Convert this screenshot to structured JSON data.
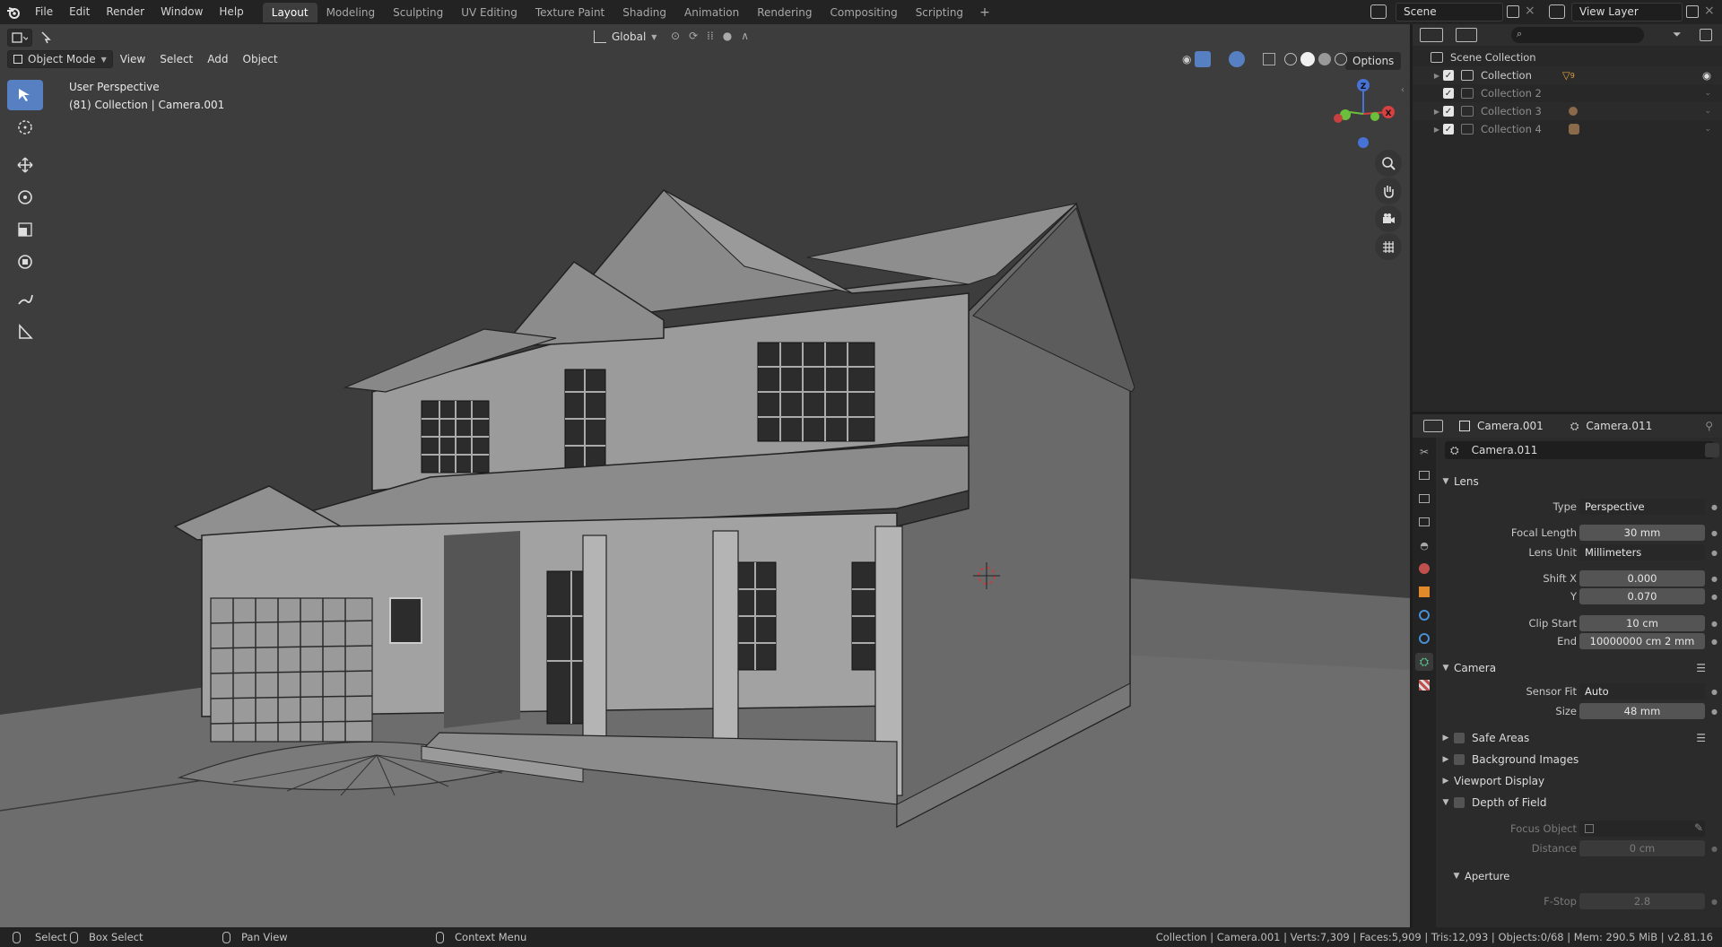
{
  "menu": {
    "items": [
      "File",
      "Edit",
      "Render",
      "Window",
      "Help"
    ]
  },
  "workspaces": {
    "tabs": [
      "Layout",
      "Modeling",
      "Sculpting",
      "UV Editing",
      "Texture Paint",
      "Shading",
      "Animation",
      "Rendering",
      "Compositing",
      "Scripting"
    ],
    "active": "Layout",
    "add_label": "+"
  },
  "scene": {
    "name": "Scene",
    "view_layer": "View Layer"
  },
  "viewport": {
    "mode": "Object Mode",
    "menus": [
      "View",
      "Select",
      "Add",
      "Object"
    ],
    "orientation": "Global",
    "options_label": "Options",
    "info_line1": "User Perspective",
    "info_line2": "(81) Collection | Camera.001",
    "gizmo": {
      "x": "X",
      "z": "Z"
    }
  },
  "outliner": {
    "root": "Scene Collection",
    "items": [
      {
        "label": "Collection",
        "excluded": false,
        "badge": "9"
      },
      {
        "label": "Collection 2",
        "excluded": true,
        "badge": ""
      },
      {
        "label": "Collection 3",
        "excluded": true,
        "badge": ""
      },
      {
        "label": "Collection 4",
        "excluded": true,
        "badge": ""
      }
    ]
  },
  "properties": {
    "header_object": "Camera.001",
    "header_data": "Camera.011",
    "data_name": "Camera.011",
    "lens": {
      "title": "Lens",
      "type_label": "Type",
      "type_value": "Perspective",
      "focal_label": "Focal Length",
      "focal_value": "30 mm",
      "lens_unit_label": "Lens Unit",
      "lens_unit_value": "Millimeters",
      "shiftx_label": "Shift X",
      "shiftx_value": "0.000",
      "shifty_label": "Y",
      "shifty_value": "0.070",
      "clip_start_label": "Clip Start",
      "clip_start_value": "10 cm",
      "clip_end_label": "End",
      "clip_end_value": "10000000 cm 2 mm"
    },
    "camera": {
      "title": "Camera",
      "sensor_fit_label": "Sensor Fit",
      "sensor_fit_value": "Auto",
      "size_label": "Size",
      "size_value": "48 mm"
    },
    "safe_areas": "Safe Areas",
    "background_images": "Background Images",
    "viewport_display": "Viewport Display",
    "dof": {
      "title": "Depth of Field",
      "focus_label": "Focus Object",
      "distance_label": "Distance",
      "distance_value": "0 cm",
      "aperture_title": "Aperture",
      "fstop_label": "F-Stop",
      "fstop_value": "2.8"
    }
  },
  "statusbar": {
    "select": "Select",
    "box_select": "Box Select",
    "pan_view": "Pan View",
    "context_menu": "Context Menu",
    "stats": "Collection | Camera.001 | Verts:7,309 | Faces:5,909 | Tris:12,093 | Objects:0/68 | Mem: 290.5 MiB | v2.81.16"
  },
  "colors": {
    "accent": "#5680c2",
    "viewport_bg": "#3d3d3d",
    "panel_bg": "#2b2b2b"
  }
}
